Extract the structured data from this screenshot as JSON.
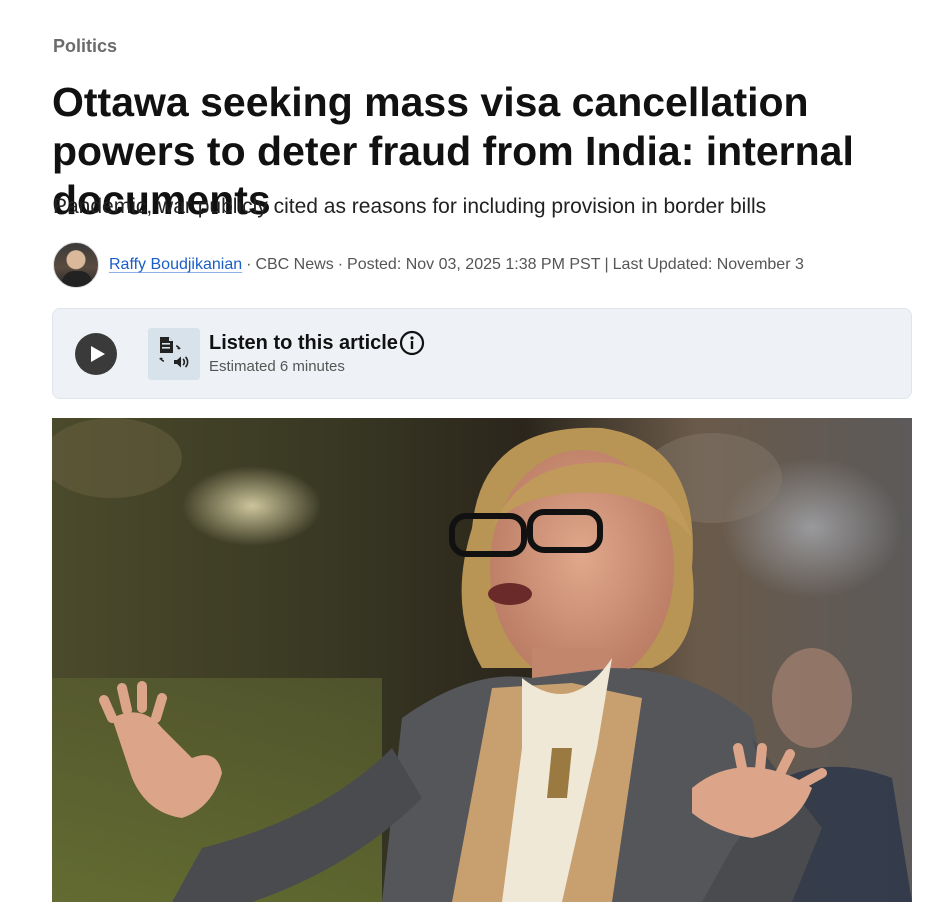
{
  "section": "Politics",
  "headline": "Ottawa seeking mass visa cancellation powers to deter fraud from India: internal documents",
  "subheadline": "Pandemic, war publicly cited as reasons for including provision in border bills",
  "byline": {
    "author": "Raffy Boudjikanian",
    "separator": "·",
    "outlet": "CBC News",
    "posted": "Posted: Nov 03, 2025 1:38 PM PST",
    "divider": "|",
    "updated": "Last Updated: November 3"
  },
  "audio": {
    "title": "Listen to this article",
    "estimate": "Estimated 6 minutes",
    "play_icon": "play-icon",
    "tts_icon": "text-to-speech-icon",
    "info_icon": "info-icon"
  },
  "colors": {
    "author_link": "#1a5ec7",
    "audio_box_bg": "#eef2f6",
    "section_label": "#6b6b6b"
  }
}
